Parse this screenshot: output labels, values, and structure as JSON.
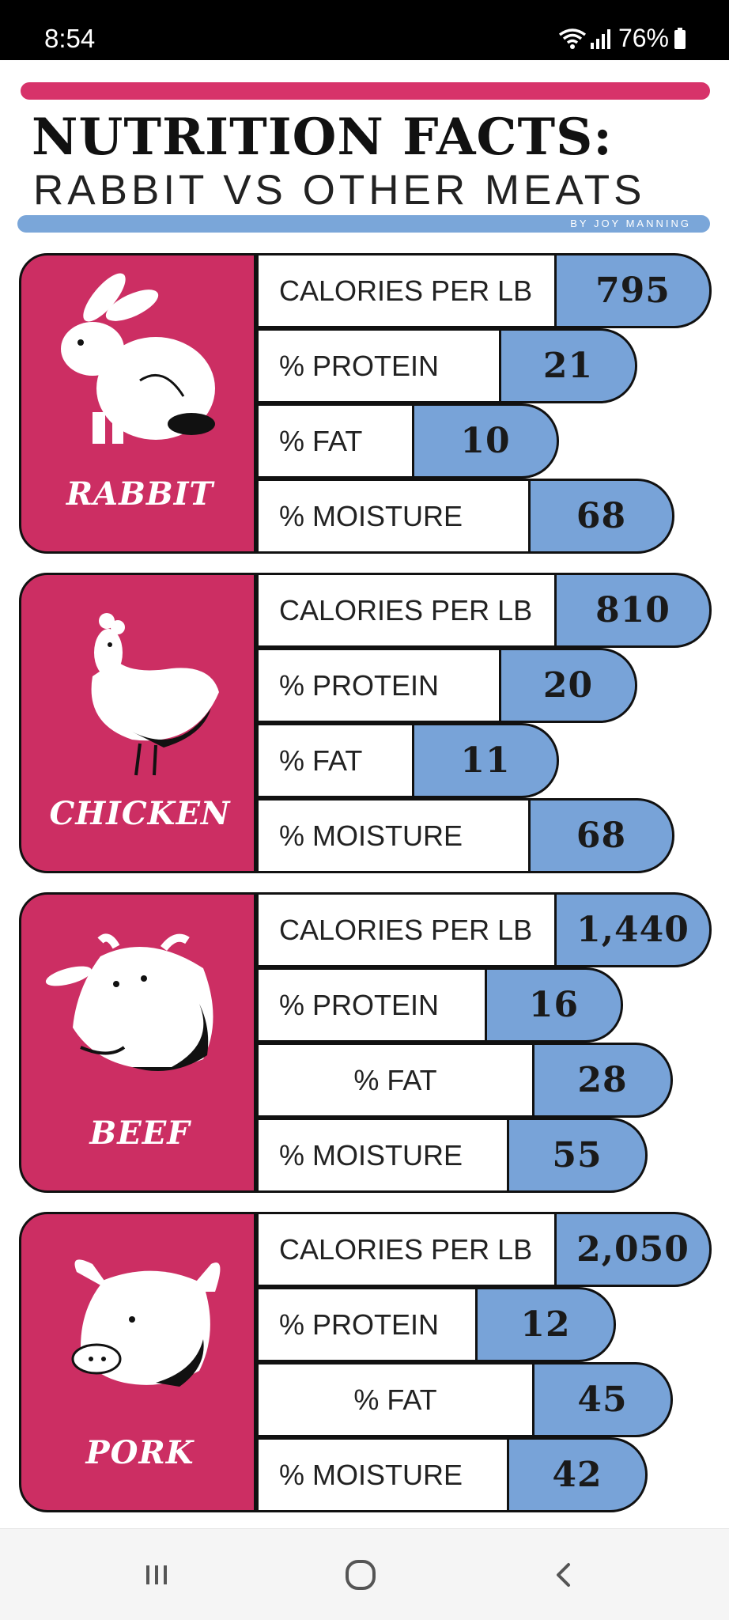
{
  "status": {
    "time": "8:54",
    "battery": "76%"
  },
  "header": {
    "title": "NUTRITION FACTS:",
    "subtitle": "RABBIT VS OTHER MEATS",
    "byline": "BY JOY MANNING"
  },
  "colors": {
    "accent_pink": "#cc2e63",
    "accent_blue": "#78a3d8"
  },
  "animals": [
    {
      "name": "RABBIT",
      "icon": "rabbit-icon",
      "stats": [
        {
          "label": "CALORIES PER LB",
          "value": "795"
        },
        {
          "label": "% PROTEIN",
          "value": "21"
        },
        {
          "label": "% FAT",
          "value": "10"
        },
        {
          "label": "% MOISTURE",
          "value": "68"
        }
      ]
    },
    {
      "name": "CHICKEN",
      "icon": "chicken-icon",
      "stats": [
        {
          "label": "CALORIES PER LB",
          "value": "810"
        },
        {
          "label": "% PROTEIN",
          "value": "20"
        },
        {
          "label": "% FAT",
          "value": "11"
        },
        {
          "label": "% MOISTURE",
          "value": "68"
        }
      ]
    },
    {
      "name": "BEEF",
      "icon": "cow-icon",
      "stats": [
        {
          "label": "CALORIES PER LB",
          "value": "1,440"
        },
        {
          "label": "% PROTEIN",
          "value": "16"
        },
        {
          "label": "% FAT",
          "value": "28"
        },
        {
          "label": "% MOISTURE",
          "value": "55"
        }
      ]
    },
    {
      "name": "PORK",
      "icon": "pig-icon",
      "stats": [
        {
          "label": "CALORIES PER LB",
          "value": "2,050"
        },
        {
          "label": "% PROTEIN",
          "value": "12"
        },
        {
          "label": "% FAT",
          "value": "45"
        },
        {
          "label": "% MOISTURE",
          "value": "42"
        }
      ]
    }
  ],
  "nav": {
    "recents": "recents-icon",
    "home": "home-icon",
    "back": "back-icon"
  }
}
